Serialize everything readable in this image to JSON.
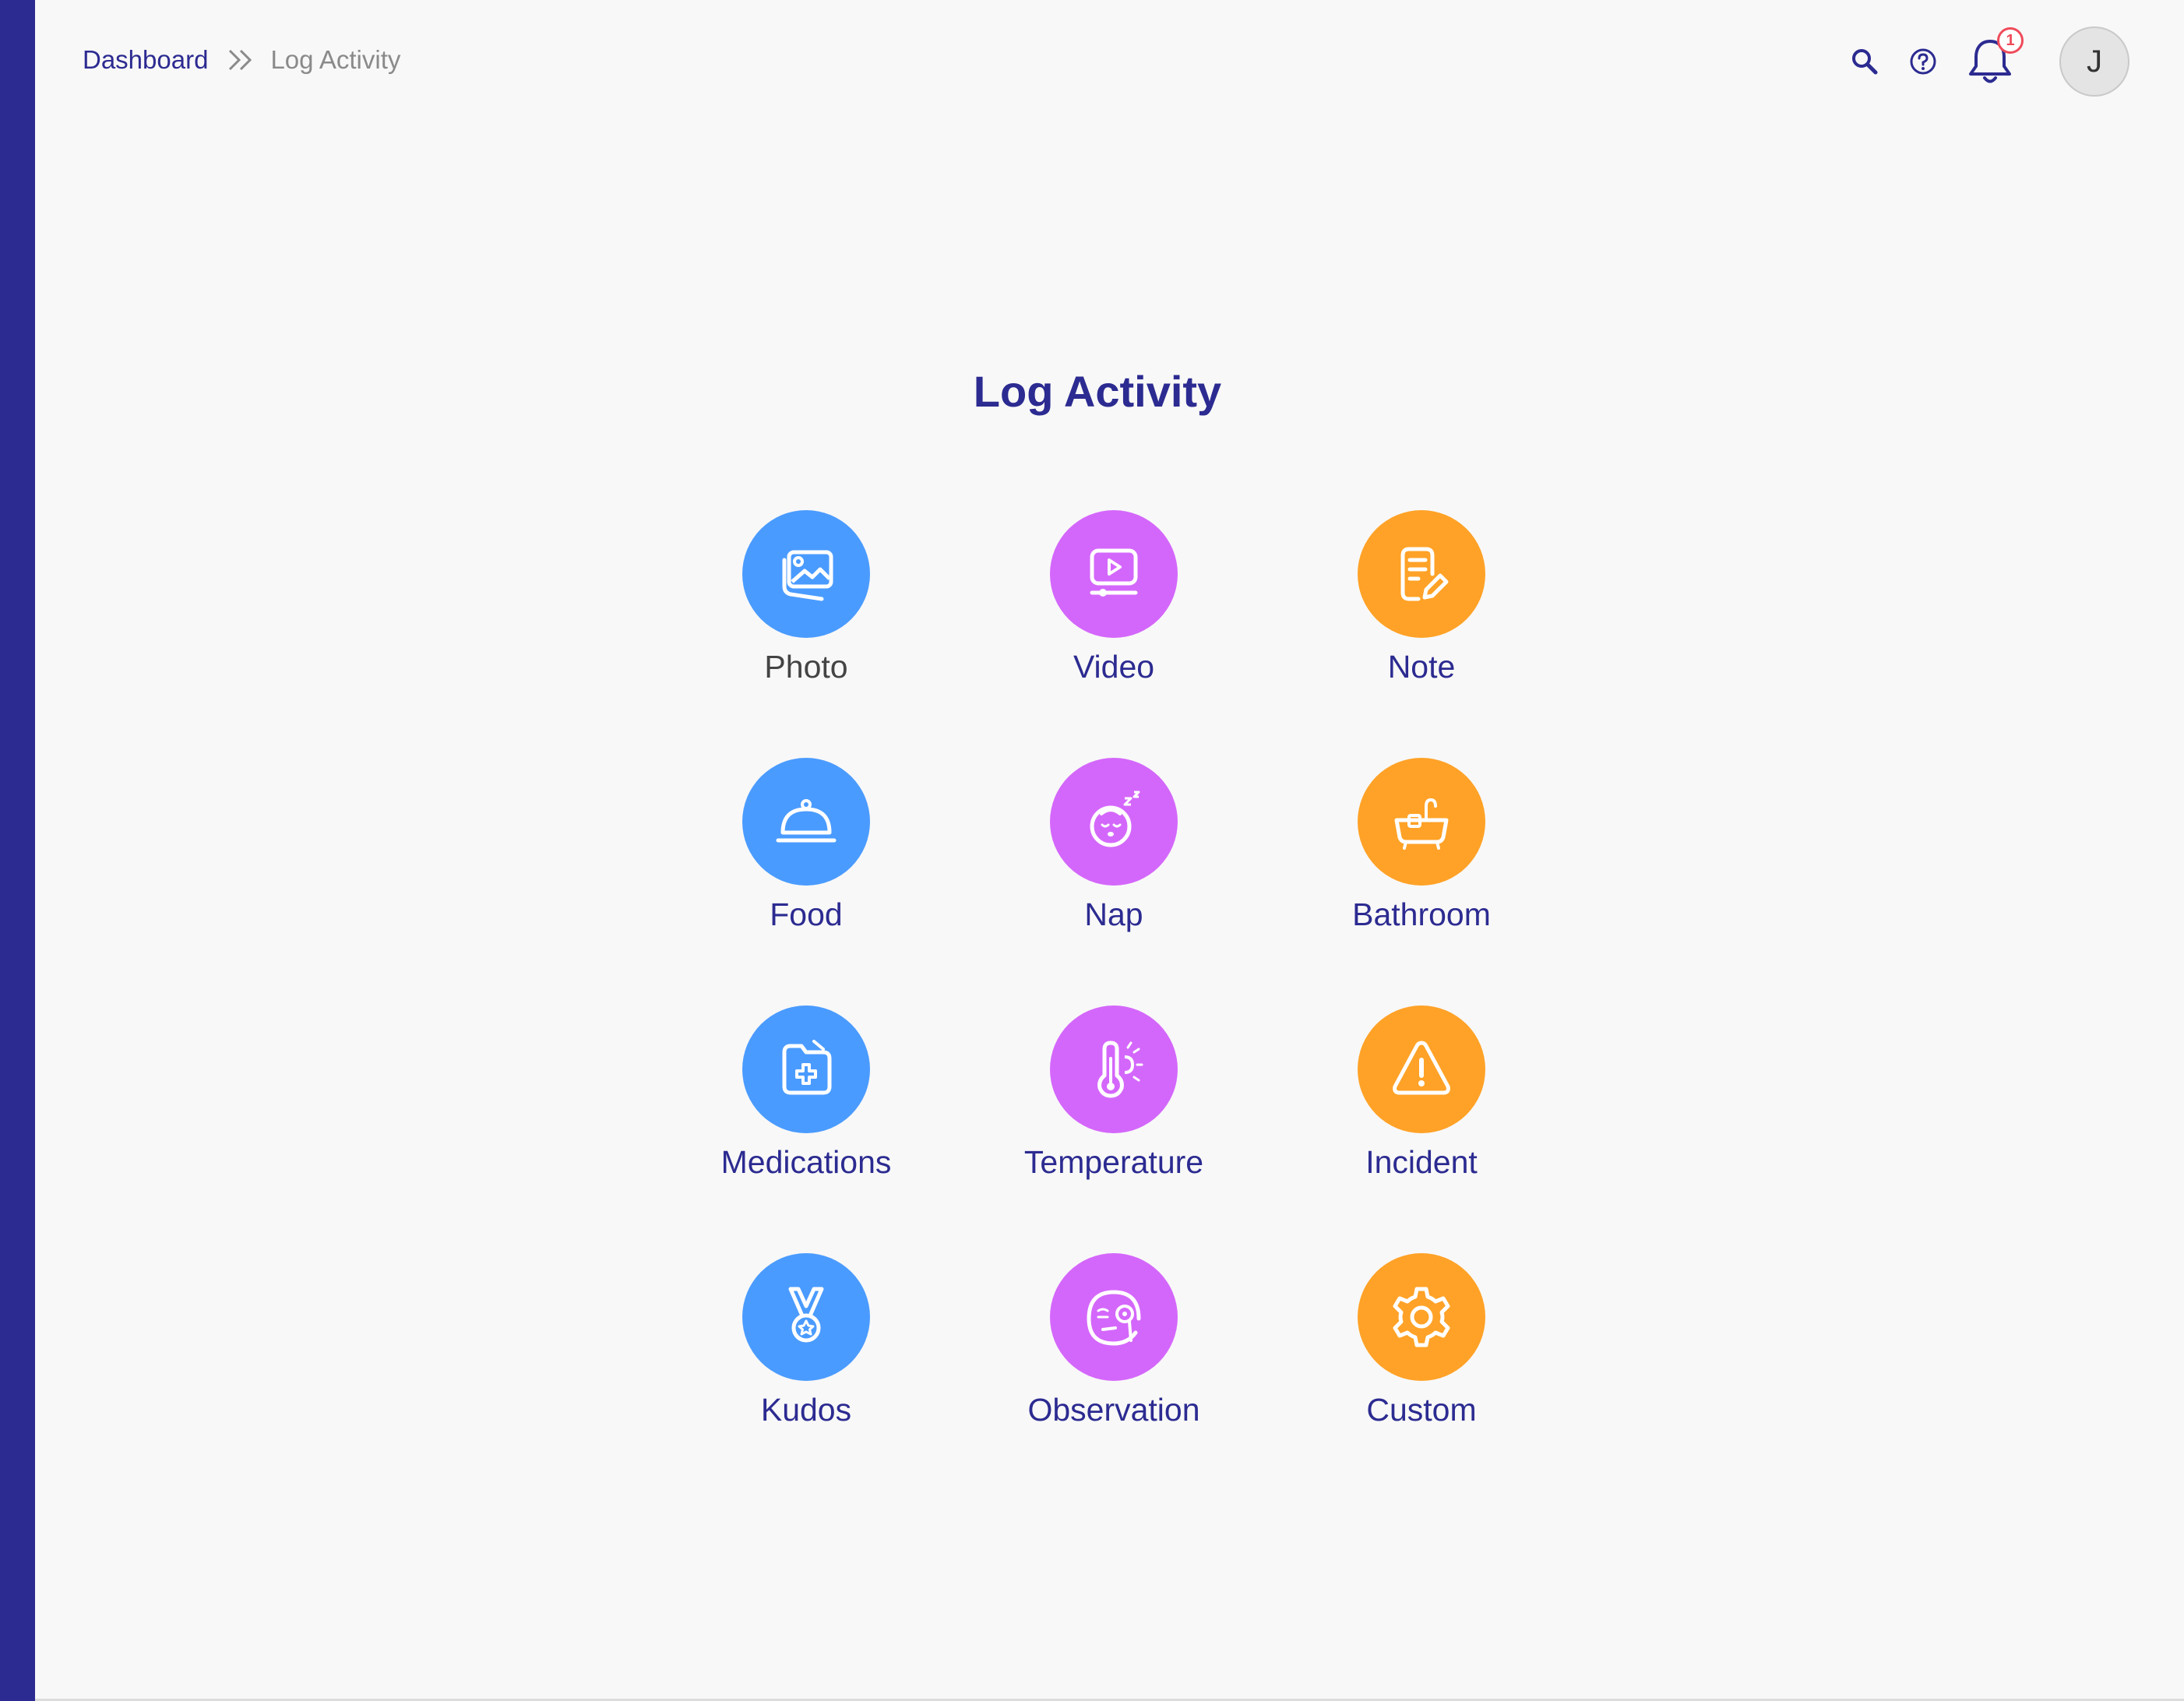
{
  "breadcrumb": {
    "parent": "Dashboard",
    "current": "Log Activity"
  },
  "header": {
    "notification_count": "1",
    "avatar_initial": "J"
  },
  "page": {
    "title": "Log Activity"
  },
  "colors": {
    "primary": "#2c2b91",
    "blue": "#4a9bff",
    "purple": "#d467fb",
    "orange": "#ffa227",
    "badge": "#ef4b5a"
  },
  "activities": [
    {
      "label": "Photo",
      "icon": "photo-icon",
      "color": "blue"
    },
    {
      "label": "Video",
      "icon": "video-icon",
      "color": "purple"
    },
    {
      "label": "Note",
      "icon": "note-icon",
      "color": "orange"
    },
    {
      "label": "Food",
      "icon": "food-cloche-icon",
      "color": "blue"
    },
    {
      "label": "Nap",
      "icon": "sleeping-baby-icon",
      "color": "purple"
    },
    {
      "label": "Bathroom",
      "icon": "bathtub-icon",
      "color": "orange"
    },
    {
      "label": "Medications",
      "icon": "medical-folder-icon",
      "color": "blue"
    },
    {
      "label": "Temperature",
      "icon": "thermometer-icon",
      "color": "purple"
    },
    {
      "label": "Incident",
      "icon": "warning-icon",
      "color": "orange"
    },
    {
      "label": "Kudos",
      "icon": "medal-icon",
      "color": "blue"
    },
    {
      "label": "Observation",
      "icon": "observation-face-icon",
      "color": "purple"
    },
    {
      "label": "Custom",
      "icon": "gear-icon",
      "color": "orange"
    }
  ]
}
